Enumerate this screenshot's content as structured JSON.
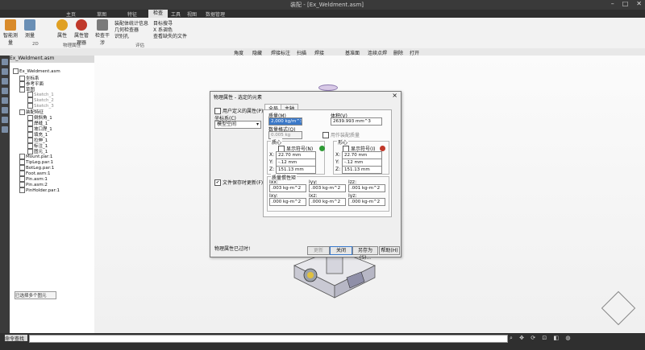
{
  "window": {
    "title": "装配 - [Ex_Weldment.asm]",
    "min_icon": "minimize-icon",
    "max_icon": "maximize-icon",
    "close_icon": "close-icon"
  },
  "ribbon_tabs": [
    {
      "label": "主页"
    },
    {
      "label": "草图"
    },
    {
      "label": "特征"
    },
    {
      "label": "检查"
    },
    {
      "label": "工具"
    },
    {
      "label": "视图"
    },
    {
      "label": "数据管理"
    }
  ],
  "ribbon": {
    "buttons": [
      {
        "label": "智能测量"
      },
      {
        "label": "测量"
      },
      {
        "label": "属性"
      },
      {
        "label": "属性管理器"
      },
      {
        "label": "检查干涉"
      }
    ],
    "small_items": [
      "装配体统计信息",
      "几何检查器",
      "识别孔",
      "目标搜寻",
      "X 系调色",
      "查看缺失的文件"
    ],
    "groups": [
      "2D",
      "物理属性",
      "评估"
    ]
  },
  "command_bar": [
    "角度",
    "隐藏",
    "焊接标注",
    "扫描",
    "焊接",
    "基准面",
    "连续点焊",
    "删除",
    "打开"
  ],
  "tree": {
    "tab_label": "Ex_Weldment.asm",
    "rows": [
      "Ex_Weldment.asm",
      "坐标系",
      "参考平面",
      "草图",
      "Sketch_1",
      "Sketch_2",
      "Sketch_3",
      "装配特征",
      "倒斜角_1",
      "焊缝_1",
      "坡口焊_1",
      "填充_1",
      "拉伸_1",
      "标注_1",
      "图元_1",
      "Mount.par:1",
      "TipLeg.par:1",
      "BotLeg.par:1",
      "Foot.asm:1",
      "Pin.asm:1",
      "Pin.asm:2",
      "PinHolder.par:1"
    ],
    "bottom_button": "已选择多个图元"
  },
  "dialog": {
    "title": "物理属性 - 选定的元素",
    "user_defined_label": "用户定义的属性(P)",
    "coord_label": "坐标系(C)",
    "coord_value": "模型空间",
    "update_on_save_label": "文件保存时更新(F)",
    "current_label": "物理属性已过时!",
    "tabs": [
      "全局",
      "主轴"
    ],
    "density_label": "质量(M)",
    "density_value": "2,000 kg/m^3",
    "volume_label": "体积(V)",
    "volume_value": "2639.993 mm^3",
    "mass_label": "数量格式(Q)",
    "mass_value": "0.005 kg",
    "mass_check_label": "用作装配质量",
    "cog_label": "质心",
    "com_label": "形心",
    "show_symbol_label": "显示符号(N)",
    "show_symbol_label_2": "显示符号(I)",
    "cog_x": "22.70 mm",
    "cog_y": "-.12 mm",
    "cog_z": "151.13 mm",
    "com_x": "22.70 mm",
    "com_y": "-.12 mm",
    "com_z": "151.13 mm",
    "axis_x": "X:",
    "axis_y": "Y:",
    "axis_z": "Z:",
    "inertia_label": "质量惯性矩",
    "ixx_label": "Ixx:",
    "iyy_label": "Iyy:",
    "izz_label": "Izz:",
    "ixy_label": "Ixy:",
    "ixz_label": "Ixz:",
    "iyz_label": "Iyz:",
    "ixx": ".003 kg-m^2",
    "iyy": ".003 kg-m^2",
    "izz": ".001 kg-m^2",
    "ixy": ".000 kg-m^2",
    "ixz": ".000 kg-m^2",
    "iyz": ".000 kg-m^2",
    "btn_update": "更新",
    "btn_close": "关闭",
    "btn_saveas": "另存为(S)...",
    "btn_help": "帮助(H)"
  },
  "colors": {
    "selection": "#3a78c8",
    "cog_marker": "#2e9b35",
    "com_marker": "#c0392b"
  }
}
